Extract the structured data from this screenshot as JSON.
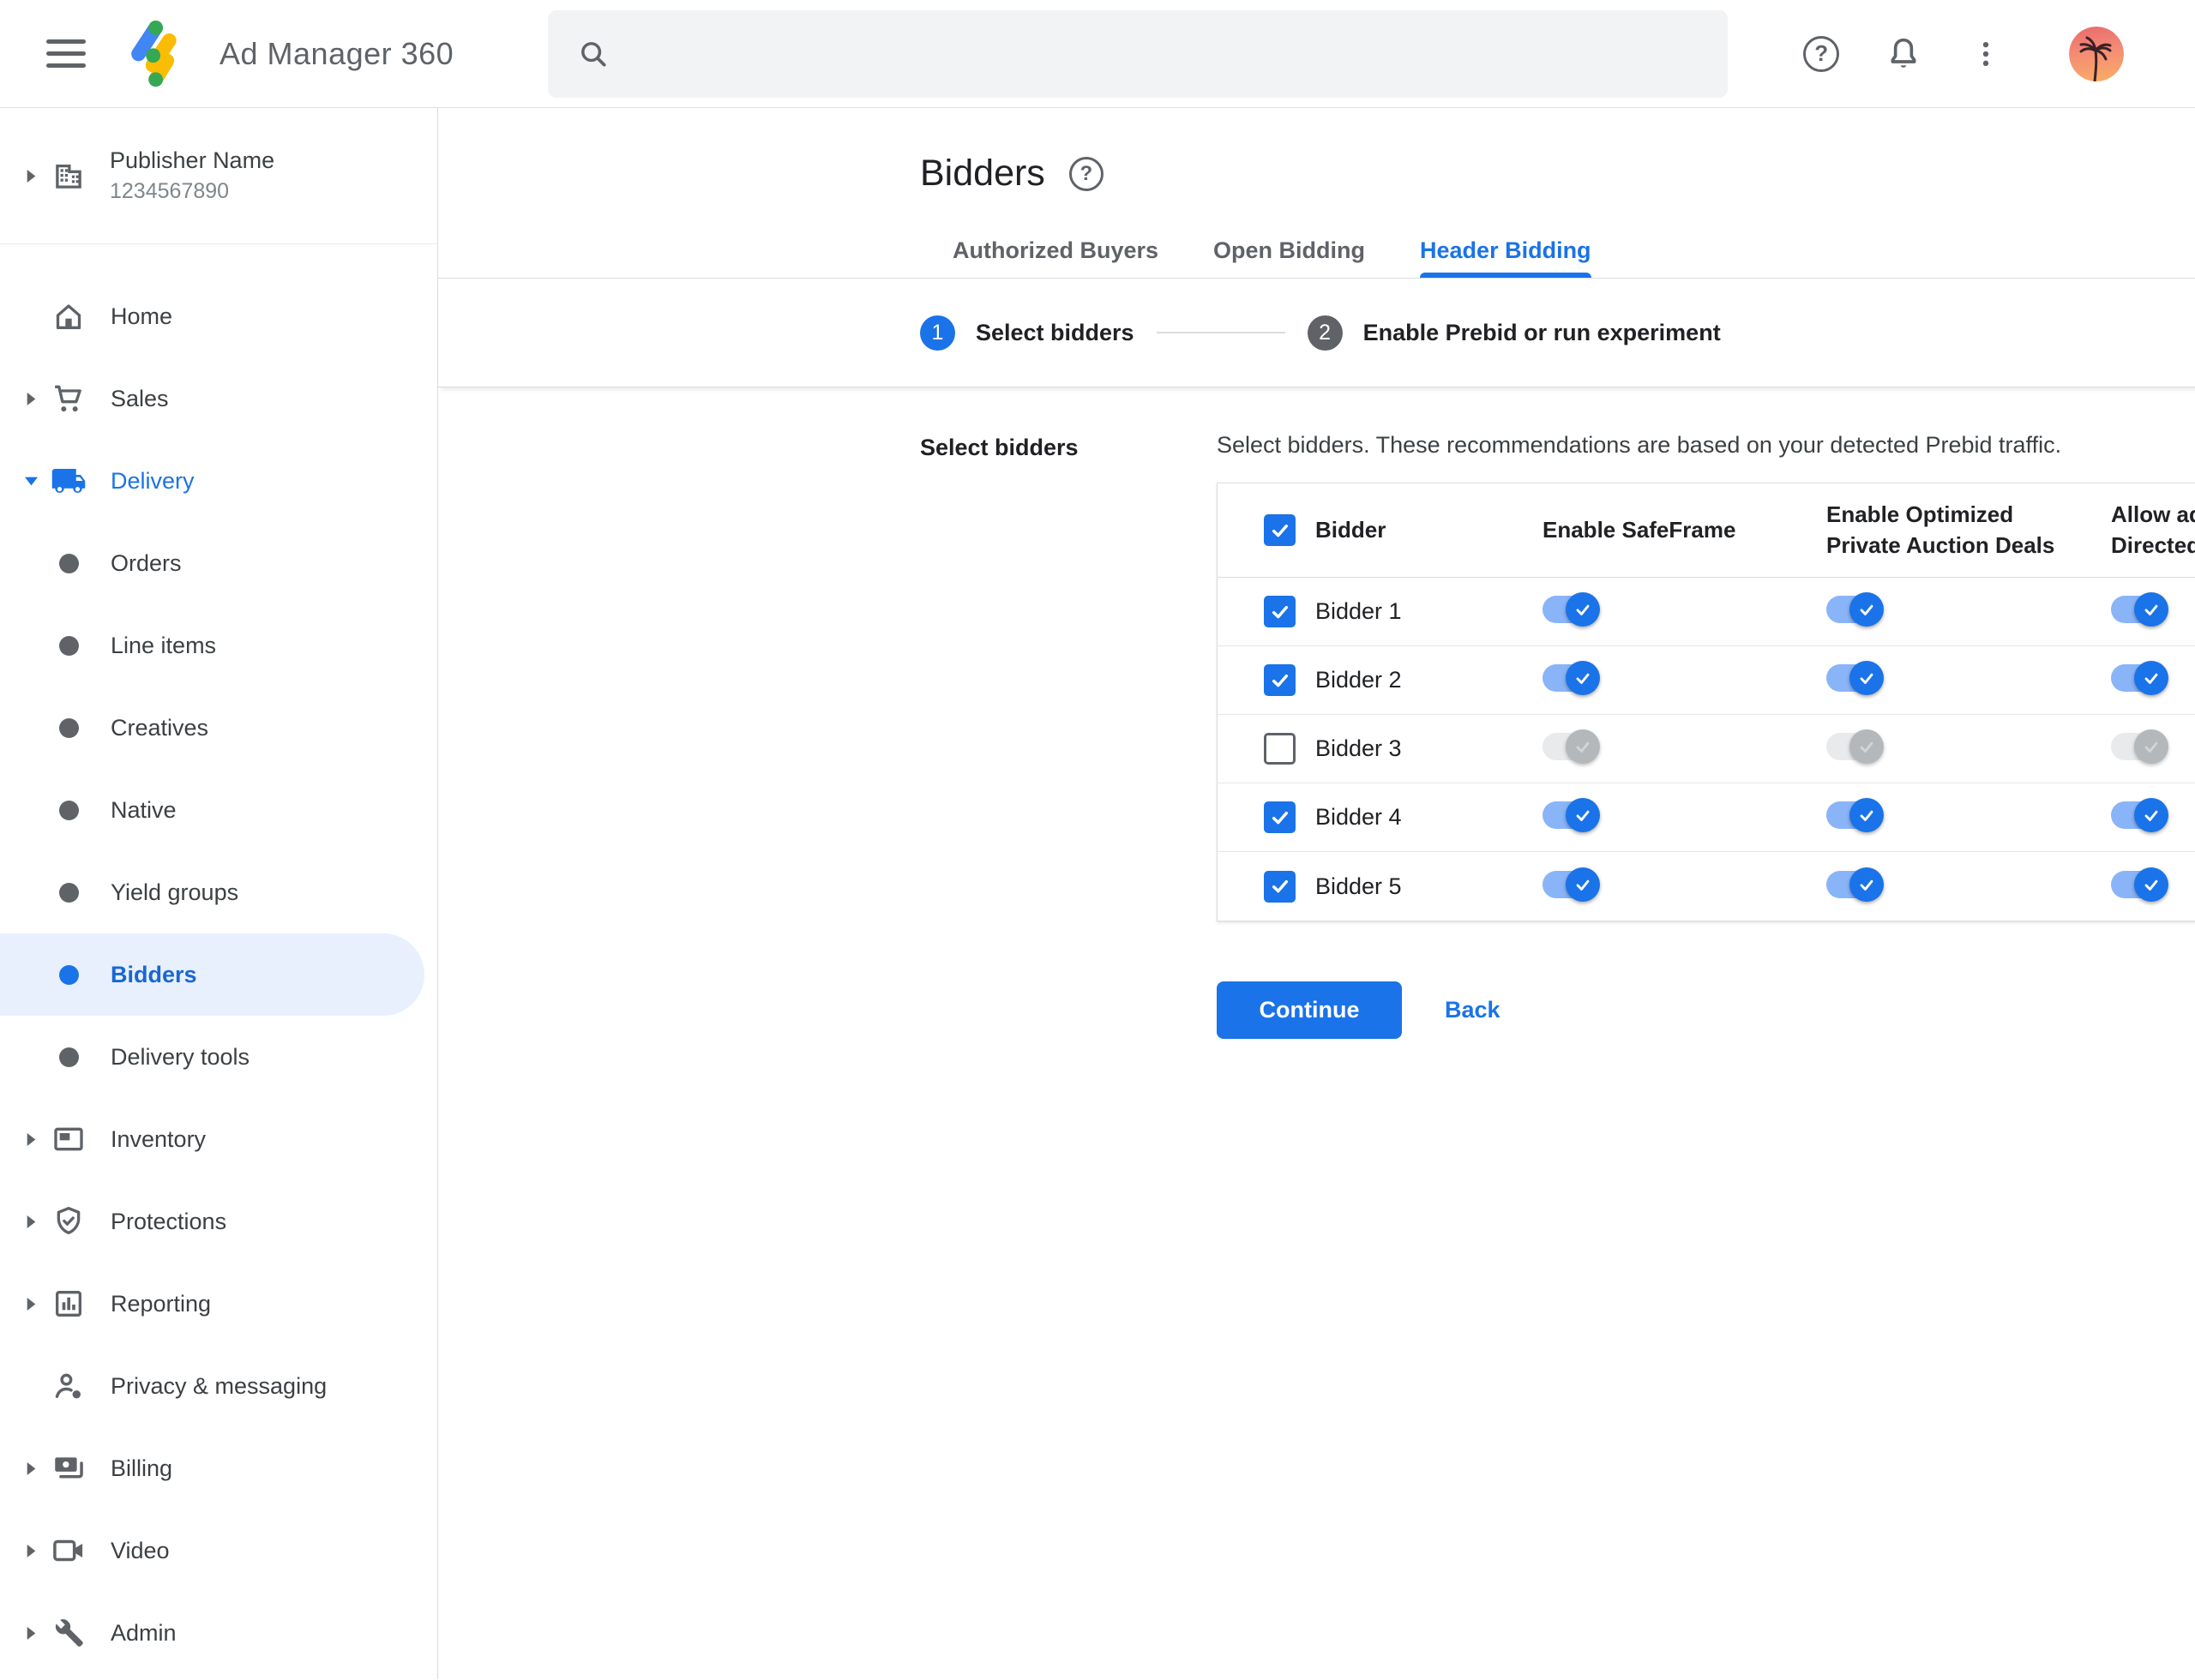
{
  "topbar": {
    "app_title": "Ad Manager 360",
    "search": {
      "placeholder": "",
      "value": ""
    }
  },
  "sidebar": {
    "publisher": {
      "name": "Publisher Name",
      "network_id": "1234567890"
    },
    "items": [
      {
        "label": "Home",
        "icon": "home"
      },
      {
        "label": "Sales",
        "icon": "cart",
        "caret": "right"
      },
      {
        "label": "Delivery",
        "icon": "truck",
        "caret": "down",
        "active": true,
        "children": [
          {
            "label": "Orders"
          },
          {
            "label": "Line items"
          },
          {
            "label": "Creatives"
          },
          {
            "label": "Native"
          },
          {
            "label": "Yield groups"
          },
          {
            "label": "Bidders",
            "selected": true
          },
          {
            "label": "Delivery tools"
          }
        ]
      },
      {
        "label": "Inventory",
        "icon": "inventory",
        "caret": "right"
      },
      {
        "label": "Protections",
        "icon": "shield",
        "caret": "right"
      },
      {
        "label": "Reporting",
        "icon": "report",
        "caret": "right"
      },
      {
        "label": "Privacy & messaging",
        "icon": "privacy"
      },
      {
        "label": "Billing",
        "icon": "billing",
        "caret": "right"
      },
      {
        "label": "Video",
        "icon": "video",
        "caret": "right"
      },
      {
        "label": "Admin",
        "icon": "admin",
        "caret": "right"
      }
    ]
  },
  "main": {
    "page_title": "Bidders",
    "tabs": [
      {
        "label": "Authorized Buyers",
        "active": false
      },
      {
        "label": "Open Bidding",
        "active": false
      },
      {
        "label": "Header Bidding",
        "active": true
      }
    ],
    "stepper": [
      {
        "number": "1",
        "label": "Select bidders",
        "state": "active"
      },
      {
        "number": "2",
        "label": "Enable Prebid or run experiment",
        "state": "upcoming"
      }
    ],
    "section_label": "Select bidders",
    "description": "Select bidders. These recommendations are based on your detected Prebid traffic.",
    "table": {
      "select_all_checked": true,
      "columns": [
        "Bidder",
        "Enable SafeFrame",
        "Enable Optimized Private Auction Deals",
        "Allow ads on Child-Directed Requests"
      ],
      "rows": [
        {
          "name": "Bidder 1",
          "selected": true,
          "enable_safeframe": true,
          "enable_optimized_private_auction_deals": true,
          "allow_ads_child_directed": true
        },
        {
          "name": "Bidder 2",
          "selected": true,
          "enable_safeframe": true,
          "enable_optimized_private_auction_deals": true,
          "allow_ads_child_directed": true
        },
        {
          "name": "Bidder 3",
          "selected": false,
          "enable_safeframe": false,
          "enable_optimized_private_auction_deals": false,
          "allow_ads_child_directed": false
        },
        {
          "name": "Bidder 4",
          "selected": true,
          "enable_safeframe": true,
          "enable_optimized_private_auction_deals": true,
          "allow_ads_child_directed": true
        },
        {
          "name": "Bidder 5",
          "selected": true,
          "enable_safeframe": true,
          "enable_optimized_private_auction_deals": true,
          "allow_ads_child_directed": true
        }
      ]
    },
    "actions": {
      "continue_label": "Continue",
      "back_label": "Back"
    }
  },
  "colors": {
    "accent": "#1a73e8",
    "accent_track": "#8ab4f8",
    "selected_nav_bg": "#e8f0fe",
    "border": "#dadce0",
    "toggle_off_track": "#e9eaeb",
    "toggle_off_thumb": "#b4b8bb",
    "step_inactive": "#5f6368",
    "text_primary": "#202124",
    "text_secondary": "#5f6368"
  }
}
